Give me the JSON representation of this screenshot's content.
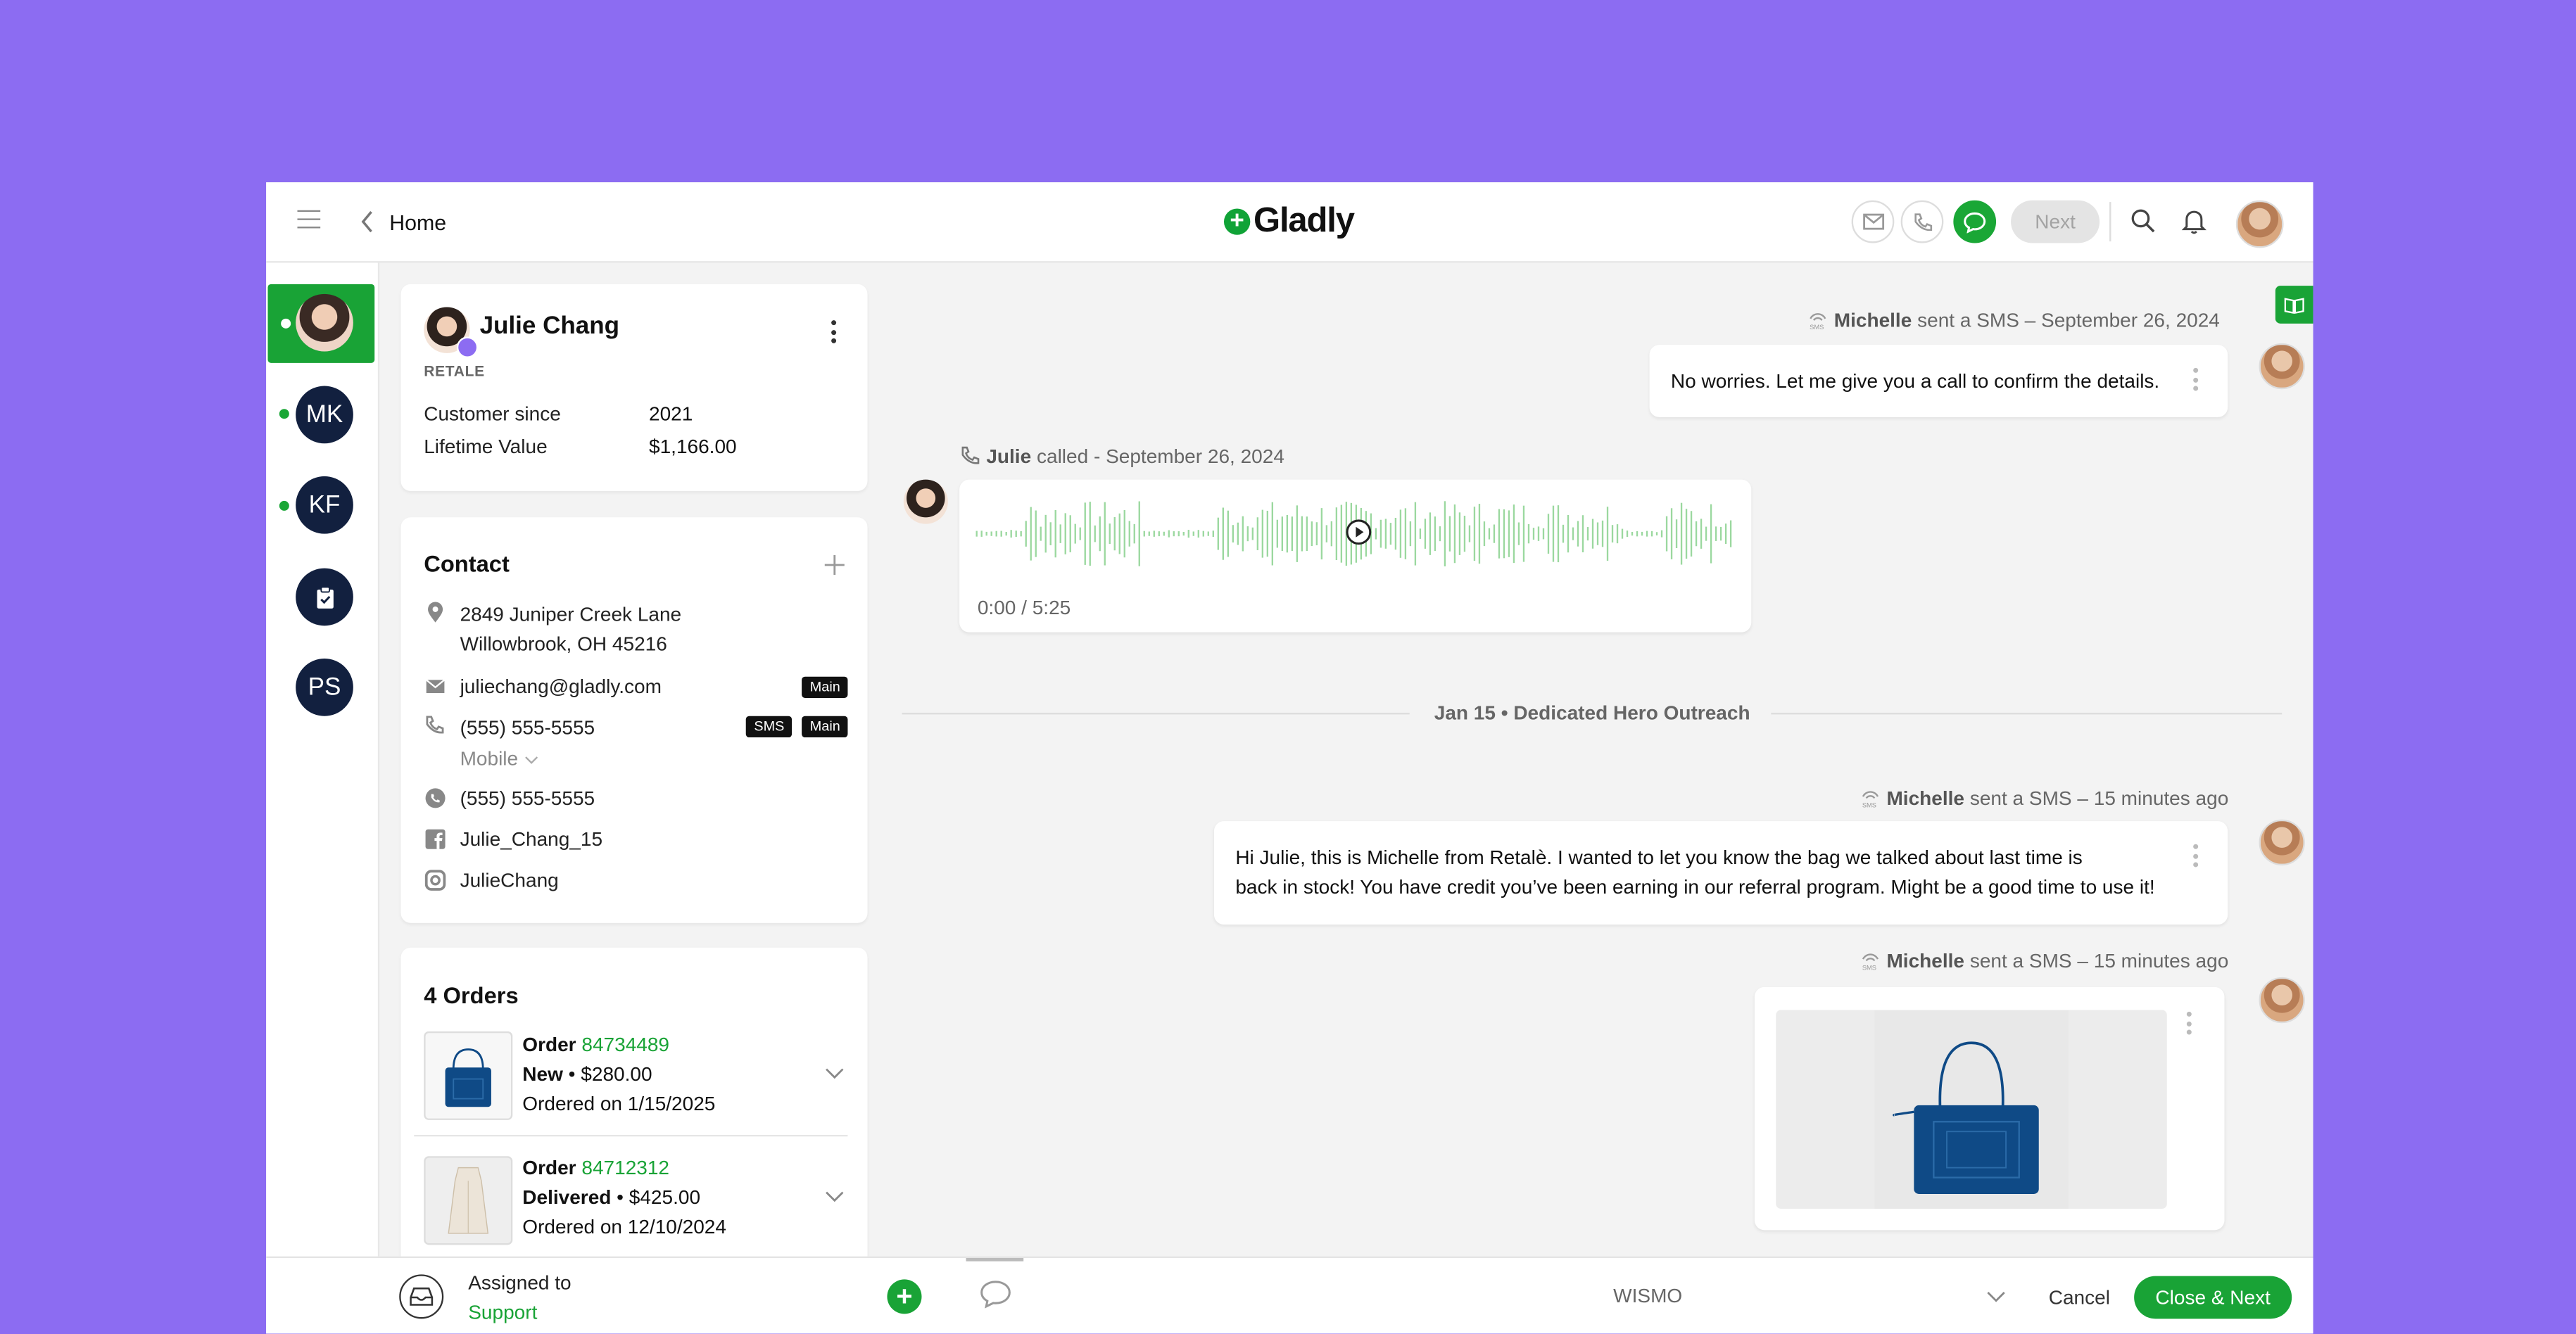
{
  "colors": {
    "background": "#8c6cf2",
    "accent": "#19a336",
    "avatar_dark": "#12203f"
  },
  "topbar": {
    "menu_icon": "hamburger-icon",
    "back_icon": "chevron-left-icon",
    "home_label": "Home",
    "logo_text": "Gladly",
    "channel_icons": [
      "email-icon",
      "phone-icon",
      "chat-icon"
    ],
    "next_label": "Next",
    "search_icon": "search-icon",
    "bell_icon": "bell-icon"
  },
  "rail": {
    "conversations": [
      {
        "initials": "",
        "photo": true,
        "online": true
      },
      {
        "initials": "MK",
        "online": true
      },
      {
        "initials": "KF",
        "online": true
      },
      {
        "initials": "",
        "icon": "clipboard-icon",
        "online": false
      },
      {
        "initials": "PS",
        "online": false
      }
    ]
  },
  "customer": {
    "name": "Julie Chang",
    "brand": "RETALE",
    "customer_since_label": "Customer since",
    "customer_since": "2021",
    "lifetime_value_label": "Lifetime Value",
    "lifetime_value": "$1,166.00"
  },
  "contact": {
    "title": "Contact",
    "address_line1": "2849 Juniper Creek Lane",
    "address_line2": "Willowbrook, OH 45216",
    "email": "juliechang@gladly.com",
    "email_tag": "Main",
    "phone": "(555) 555-5555",
    "phone_tags": [
      "SMS",
      "Main"
    ],
    "phone_type": "Mobile",
    "whatsapp": "(555) 555-5555",
    "facebook": "Julie_Chang_15",
    "instagram": "JulieChang"
  },
  "orders": {
    "title": "4 Orders",
    "items": [
      {
        "prefix": "Order",
        "number": "84734489",
        "status": "New",
        "price": "$280.00",
        "date": "Ordered on 1/15/2025"
      },
      {
        "prefix": "Order",
        "number": "84712312",
        "status": "Delivered",
        "price": "$425.00",
        "date": "Ordered on 12/10/2024"
      }
    ]
  },
  "conversation": {
    "msg1": {
      "author": "Michelle",
      "action": "sent a SMS –  September 26, 2024",
      "text": "No worries. Let me give you a call to confirm the details."
    },
    "call": {
      "author": "Julie",
      "action": "called - September 26, 2024",
      "time": "0:00 / 5:25"
    },
    "divider": "Jan 15  •  Dedicated Hero Outreach",
    "msg2": {
      "author": "Michelle",
      "action": "sent a SMS – 15 minutes ago",
      "line1": "Hi Julie, this is Michelle from Retalè. I wanted to let you know the bag we talked about last time is",
      "line2": "back in stock!  You have credit you’ve been earning in our referral program. Might be a good time to use it!"
    },
    "msg3": {
      "author": "Michelle",
      "action": "sent a SMS – 15 minutes ago"
    }
  },
  "bottombar": {
    "assigned_label": "Assigned to",
    "assigned_team": "Support",
    "topic": "WISMO",
    "cancel_label": "Cancel",
    "close_next_label": "Close & Next"
  }
}
